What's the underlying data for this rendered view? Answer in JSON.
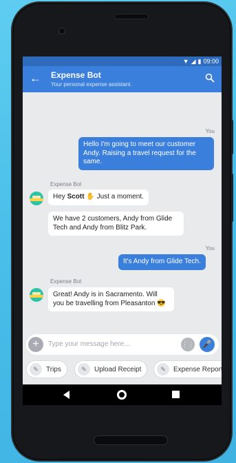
{
  "status": {
    "time": "09:00"
  },
  "appbar": {
    "title": "Expense Bot",
    "subtitle": "Your personal expense assistant."
  },
  "messages": [
    {
      "from": "You",
      "text": "Hello I'm going to meet our customer Andy. Raising a travel request for the same."
    },
    {
      "from": "Expense Bot",
      "text_pre": "Hey ",
      "text_bold": "Scott",
      "text_post": " ✋ Just a moment."
    },
    {
      "text": "We have 2 customers, Andy from Glide Tech and Andy from Blitz Park."
    },
    {
      "from": "You",
      "text": "It's Andy from Glide Tech."
    },
    {
      "from": "Expense Bot",
      "text": "Great! Andy is in Sacramento. Will you be travelling from Pleasanton 😎"
    }
  ],
  "input": {
    "placeholder": "Type your message here..."
  },
  "chips": [
    "Trips",
    "Upload Receipt",
    "Expense Report"
  ],
  "icons": {
    "back": "arrow-left-icon",
    "search": "search-icon",
    "plus": "plus-icon",
    "grid": "keypad-icon",
    "mic": "mic-icon",
    "wand": "magic-wand-icon"
  },
  "colors": {
    "primary": "#3b7fdc",
    "avatar": "#2dc2a3"
  }
}
